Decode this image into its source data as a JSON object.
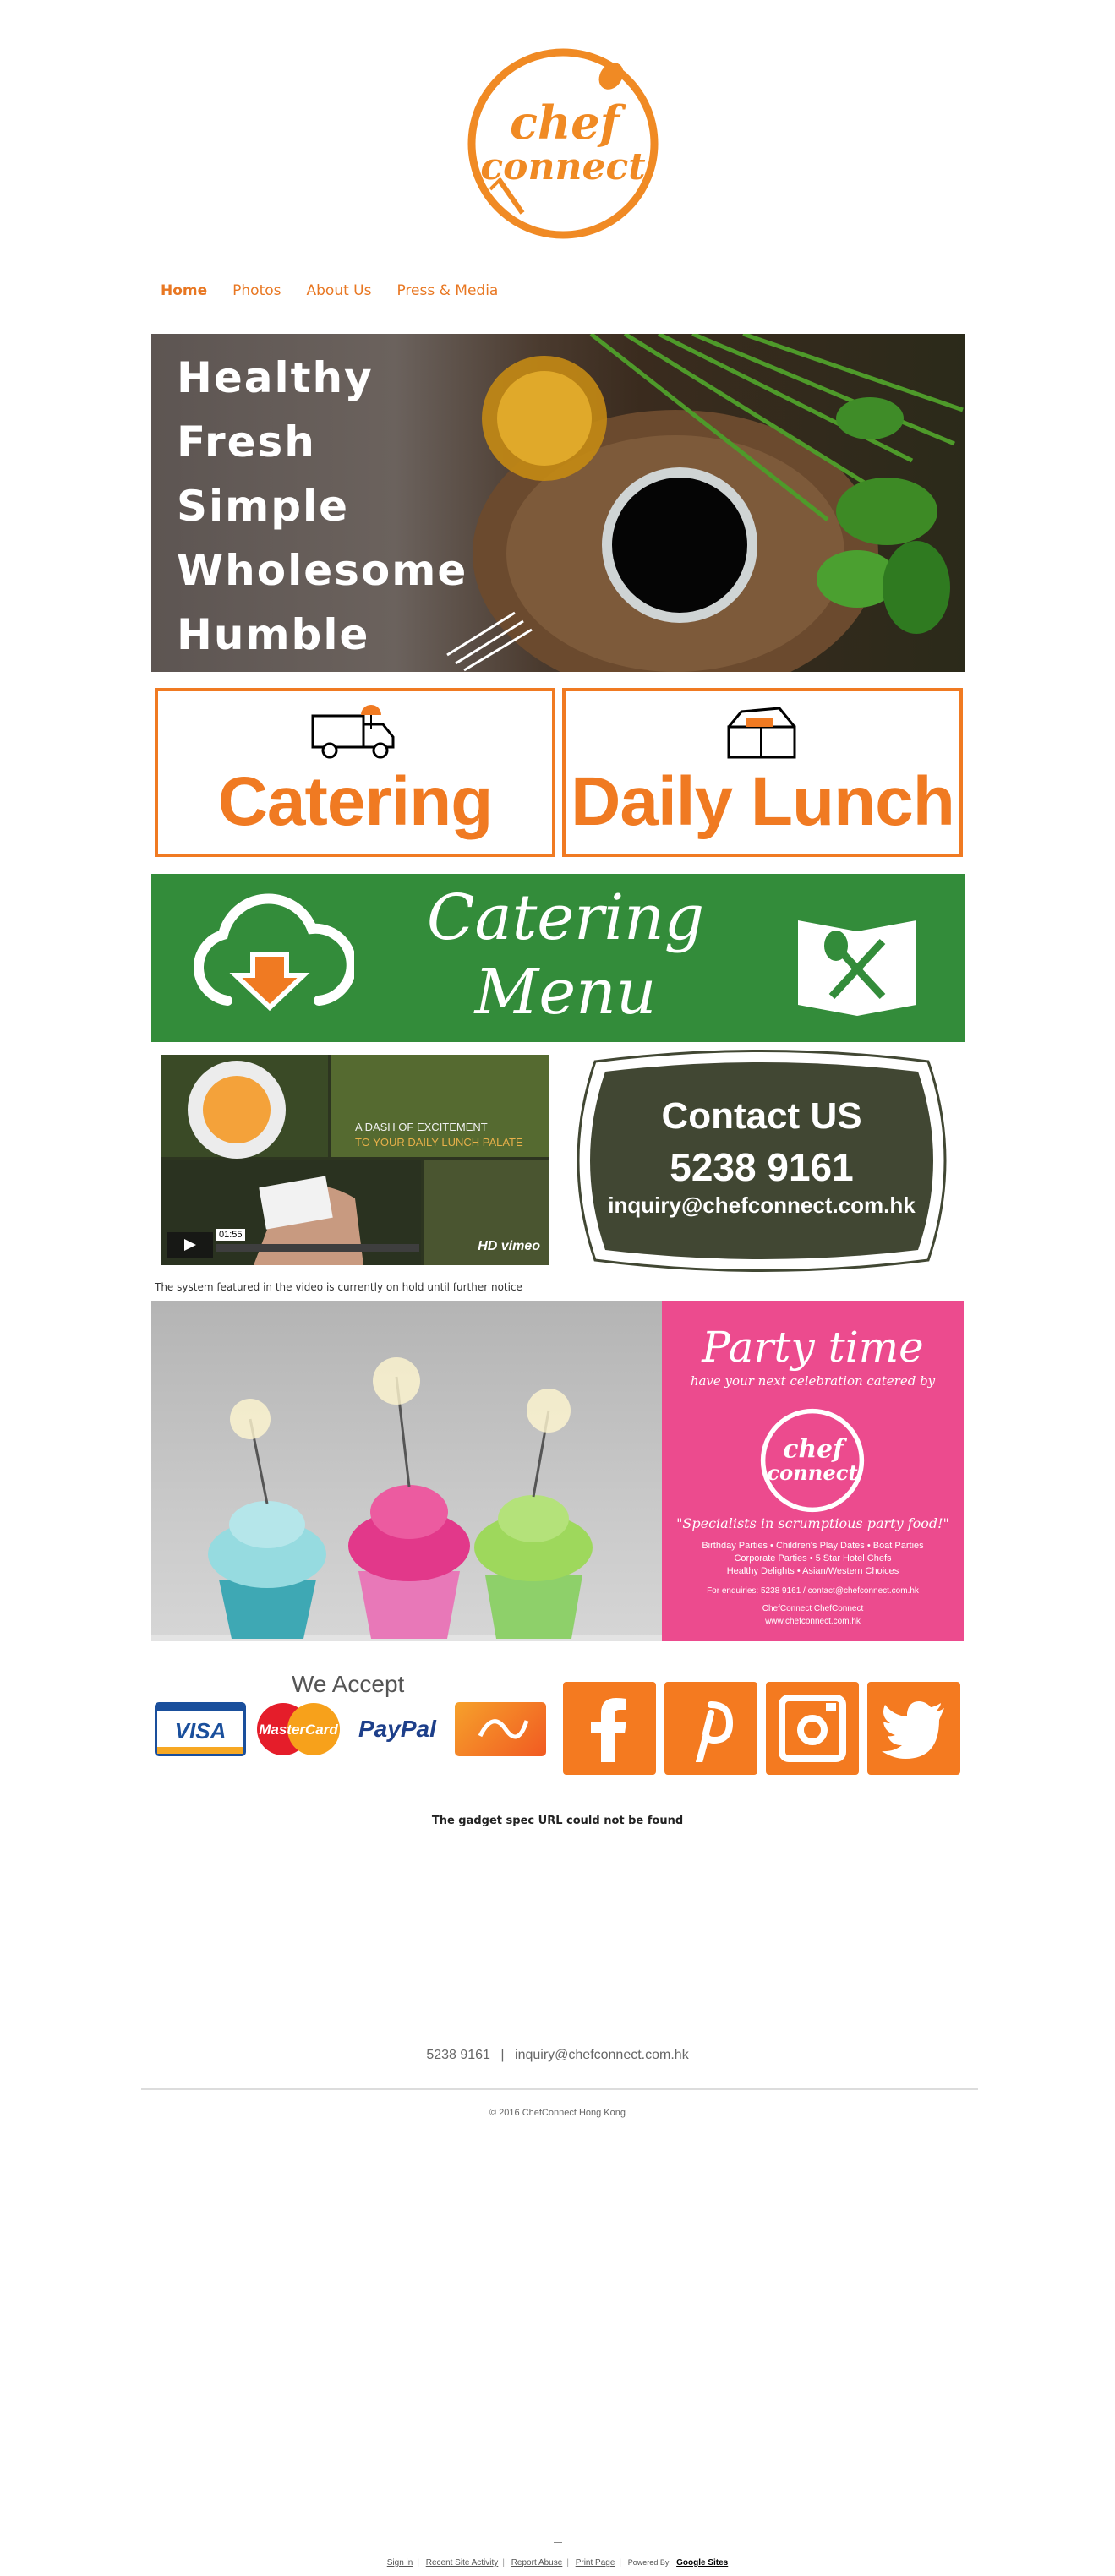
{
  "logo": {
    "line1": "chef",
    "line2": "connect",
    "color": "#f08a24"
  },
  "nav": {
    "items": [
      "Home",
      "Photos",
      "About Us",
      "Press & Media"
    ],
    "active": "Home",
    "color": "#e87722"
  },
  "hero": {
    "words": [
      "Healthy",
      "Fresh",
      "Simple",
      "Wholesome",
      "Humble"
    ]
  },
  "services": [
    {
      "label": "Catering",
      "icon": "delivery-truck-icon"
    },
    {
      "label": "Daily Lunch",
      "icon": "lunch-box-icon"
    }
  ],
  "catering_menu": {
    "line1": "Catering",
    "line2": "Menu",
    "bg": "#338c3a"
  },
  "video": {
    "overlay_line1": "A DASH OF EXCITEMENT",
    "overlay_line2": "TO YOUR DAILY LUNCH PALATE",
    "duration": "01:55",
    "quality": "HD",
    "brand": "vimeo"
  },
  "contact": {
    "title": "Contact US",
    "phone": "5238 9161",
    "email": "inquiry@chefconnect.com.hk",
    "bg": "#414733"
  },
  "notice": "The system featured in the video is currently on hold until further notice",
  "party": {
    "title": "Party time",
    "subtitle": "have your next celebration catered by",
    "quote": "\"Specialists in scrumptious party food!\"",
    "lines": [
      "Birthday Parties • Children's Play Dates • Boat Parties",
      "Corporate Parties • 5 Star Hotel Chefs",
      "Healthy Delights • Asian/Western Choices"
    ],
    "enquiries": "For enquiries:  5238 9161   /   contact@chefconnect.com.hk",
    "social": "ChefConnect     ChefConnect",
    "website": "www.chefconnect.com.hk",
    "bg": "#ec4b8e"
  },
  "payments": {
    "title": "We Accept",
    "visa": "VISA",
    "mastercard": "MasterCard",
    "paypal": "PayPal"
  },
  "social_icons": [
    "facebook-icon",
    "pinterest-icon",
    "instagram-icon",
    "twitter-icon"
  ],
  "gadget_error": "The gadget spec URL could not be found",
  "footer": {
    "phone": "5238 9161",
    "separator": "|",
    "email": "inquiry@chefconnect.com.hk",
    "copyright": "© 2016 ChefConnect Hong Kong"
  },
  "google_footer": {
    "sign_in": "Sign in",
    "recent_activity": "Recent Site Activity",
    "report_abuse": "Report Abuse",
    "print_page": "Print Page",
    "powered_by": "Powered By",
    "google_sites": "Google Sites"
  }
}
